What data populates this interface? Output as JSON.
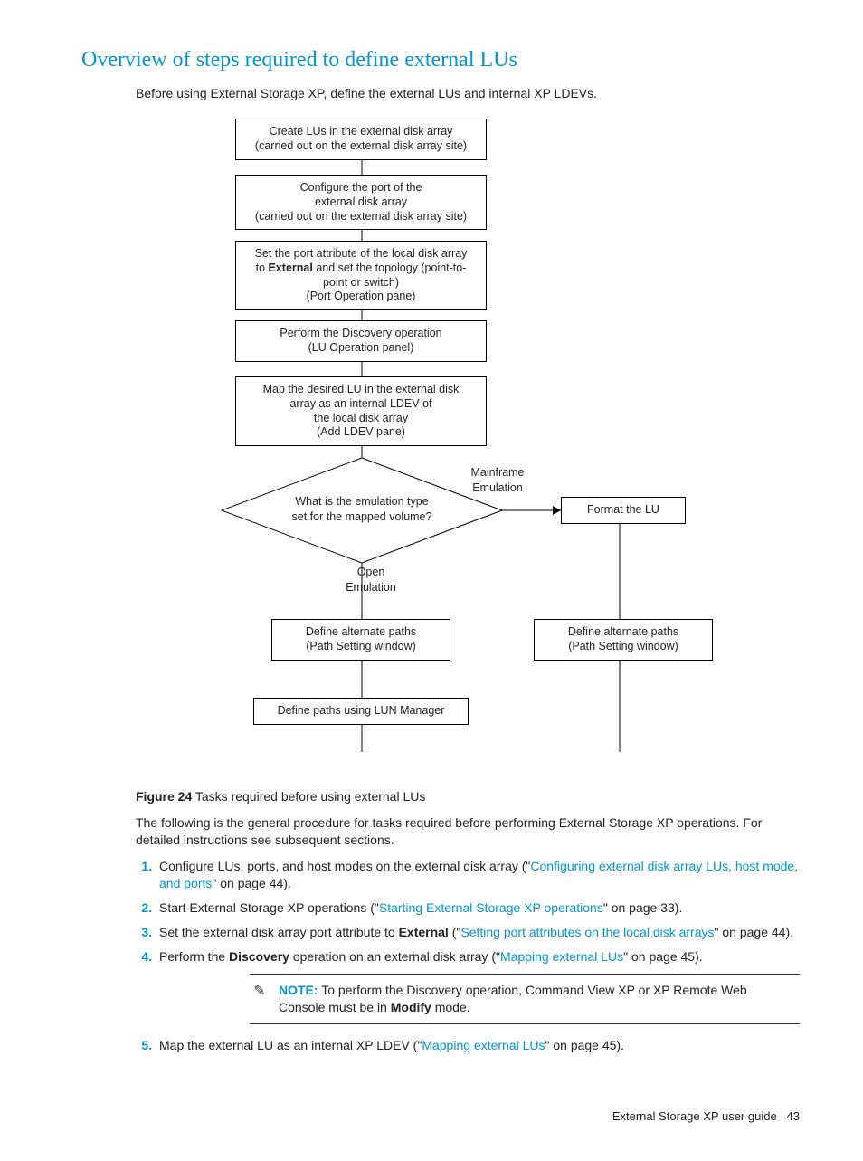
{
  "heading": "Overview of steps required to define external LUs",
  "intro": "Before using External Storage XP, define the external LUs and internal XP LDEVs.",
  "diagram": {
    "box1": "Create LUs in the external disk array\n(carried out on the external disk array site)",
    "box2": "Configure the port of the\nexternal disk array\n(carried out on the external disk array site)",
    "box3_a": "Set the port attribute of the local disk array",
    "box3_b": "to ",
    "box3_bold": "External",
    "box3_c": " and set the topology (point-to-",
    "box3_d": "point or switch)",
    "box3_e": "(Port Operation pane)",
    "box4": "Perform the Discovery operation\n(LU Operation panel)",
    "box5": "Map the desired LU in the external disk\narray as an internal LDEV of\nthe local disk array\n(Add LDEV pane)",
    "decision": "What is the emulation type\nset for the mapped volume?",
    "label_mainframe": "Mainframe\nEmulation",
    "label_open": "Open\nEmulation",
    "box_format": "Format the LU",
    "box_alt_left": "Define alternate paths\n(Path Setting window)",
    "box_alt_right": "Define alternate paths\n(Path Setting window)",
    "box_lun": "Define paths using LUN Manager"
  },
  "figure_label": "Figure 24",
  "figure_caption": " Tasks required before using external LUs",
  "para2": "The following is the general procedure for tasks required before performing External Storage XP operations. For detailed instructions see subsequent sections.",
  "steps": {
    "s1_a": "Configure LUs, ports, and host modes on the external disk array (\"",
    "s1_link": "Configuring external disk array LUs, host mode, and ports",
    "s1_b": "\" on page 44).",
    "s2_a": "Start External Storage XP operations (\"",
    "s2_link": "Starting External Storage XP operations",
    "s2_b": "\" on page 33).",
    "s3_a": "Set the external disk array port attribute to ",
    "s3_bold": "External",
    "s3_b": " (\"",
    "s3_link": "Setting port attributes on the local disk arrays",
    "s3_c": "\" on page 44).",
    "s4_a": "Perform the ",
    "s4_bold": "Discovery",
    "s4_b": " operation on an external disk array (\"",
    "s4_link": "Mapping external LUs",
    "s4_c": "\" on page 45).",
    "s5_a": "Map the external LU as an internal XP LDEV (\"",
    "s5_link": "Mapping external LUs",
    "s5_b": "\" on page 45)."
  },
  "note": {
    "label": "NOTE:",
    "text_a": "   To perform the Discovery operation, Command View XP or XP Remote Web Console must be in ",
    "text_bold": "Modify",
    "text_b": " mode."
  },
  "footer_text": "External Storage XP user guide",
  "footer_page": "43"
}
